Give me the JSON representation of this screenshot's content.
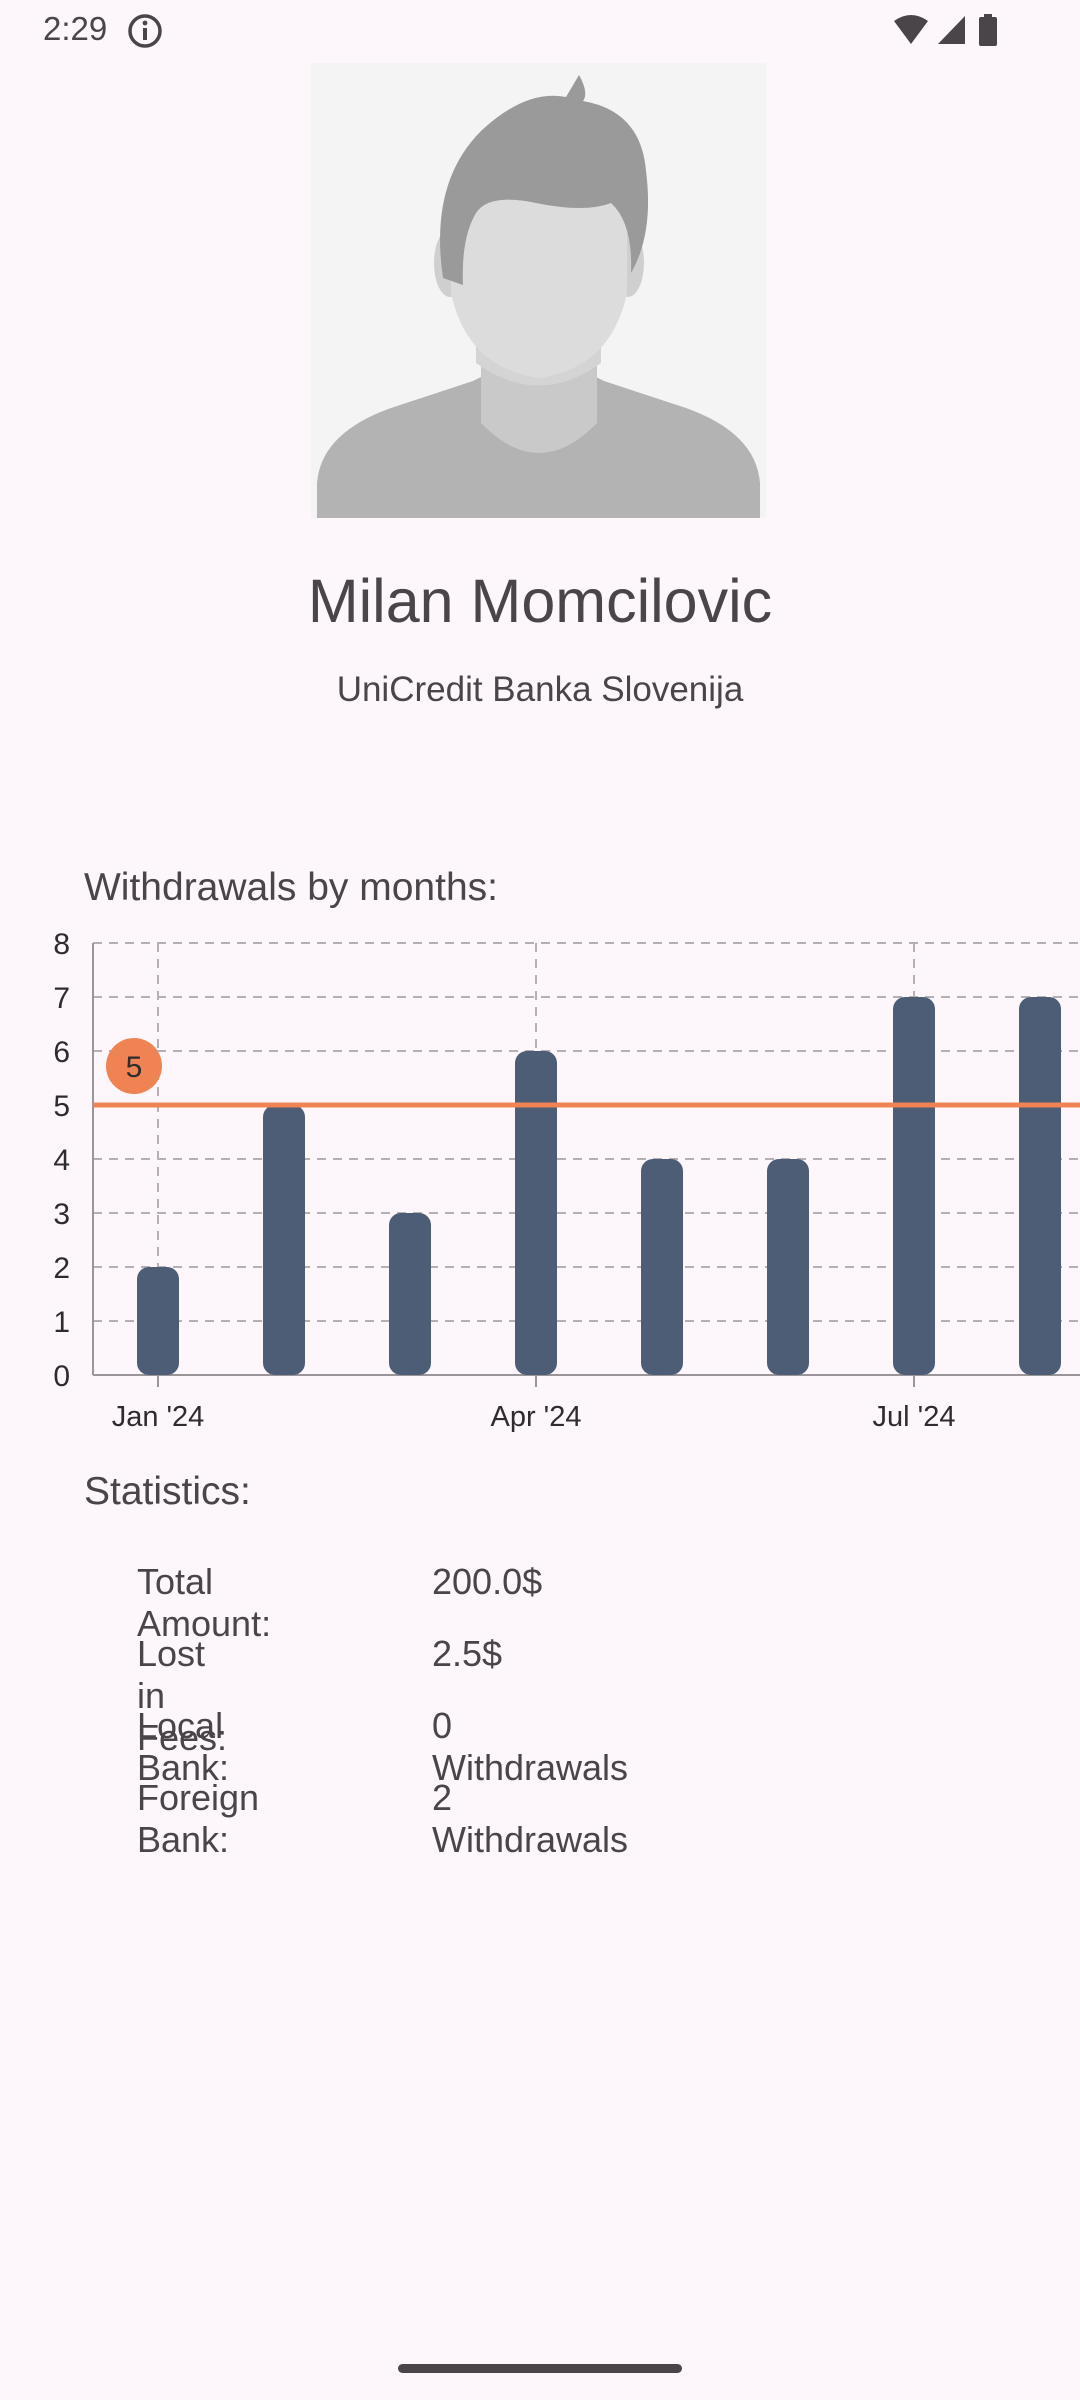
{
  "status_bar": {
    "time": "2:29"
  },
  "profile": {
    "name": "Milan Momcilovic",
    "bank": "UniCredit Banka Slovenija"
  },
  "withdrawals_section": {
    "title": "Withdrawals by months:"
  },
  "chart_data": {
    "type": "bar",
    "x": [
      "2024-01",
      "2024-02",
      "2024-03",
      "2024-04",
      "2024-05",
      "2024-06",
      "2024-07",
      "2024-08"
    ],
    "values": [
      2,
      5,
      3,
      6,
      4,
      4,
      7,
      7
    ],
    "ylim": [
      0,
      8
    ],
    "yticks": [
      "0",
      "1",
      "2",
      "3",
      "4",
      "5",
      "6",
      "7",
      "8"
    ],
    "xticks": [
      {
        "x": "2024-01",
        "label": "Jan '24"
      },
      {
        "x": "2024-04",
        "label": "Apr '24"
      },
      {
        "x": "2024-07",
        "label": "Jul '24"
      }
    ],
    "reference_line": {
      "value": 5,
      "label": "5"
    },
    "grid": true,
    "bar_color": "#4e5d76",
    "reference_color": "#ef8354"
  },
  "statistics": {
    "title": "Statistics:",
    "rows": [
      {
        "label": "Total Amount:",
        "value": "200.0$"
      },
      {
        "label": "Lost in Fees:",
        "value": "2.5$"
      },
      {
        "label": "Local Bank:",
        "value": "0 Withdrawals"
      },
      {
        "label": "Foreign Bank:",
        "value": "2 Withdrawals"
      }
    ]
  }
}
